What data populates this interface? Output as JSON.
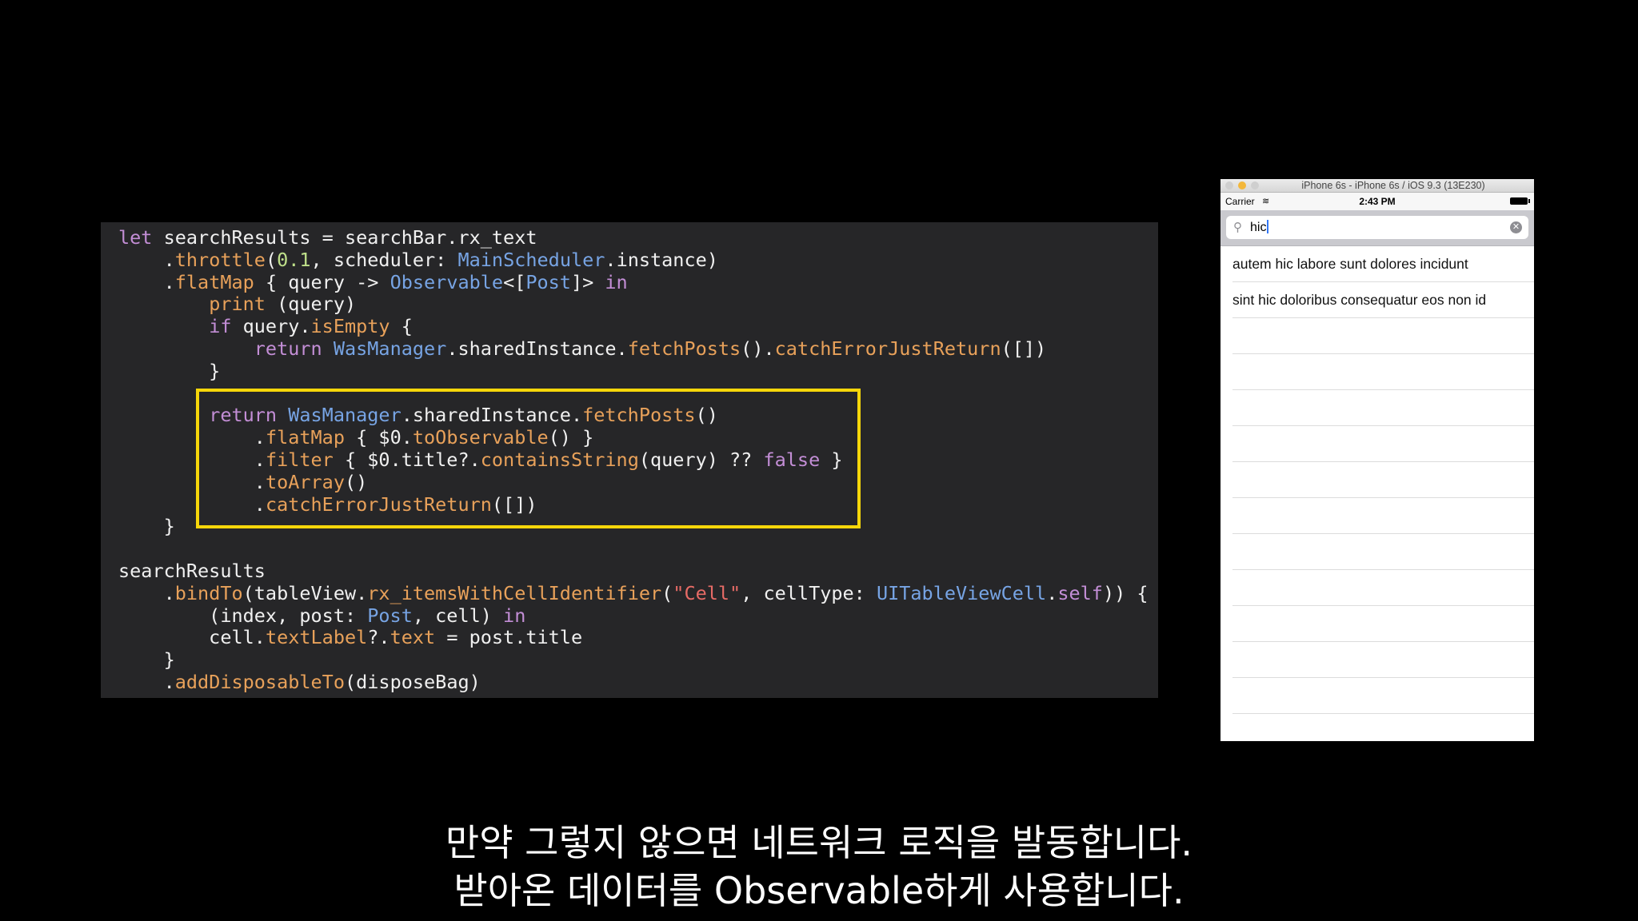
{
  "code": {
    "lines": [
      [
        [
          "k",
          "let"
        ],
        [
          "p",
          " searchResults = searchBar.rx_text"
        ]
      ],
      [
        [
          "p",
          "    ."
        ],
        [
          "f",
          "throttle"
        ],
        [
          "p",
          "("
        ],
        [
          "n",
          "0.1"
        ],
        [
          "p",
          ", scheduler: "
        ],
        [
          "ty",
          "MainScheduler"
        ],
        [
          "p",
          ".instance)"
        ]
      ],
      [
        [
          "p",
          "    ."
        ],
        [
          "f",
          "flatMap"
        ],
        [
          "p",
          " { query -> "
        ],
        [
          "ty",
          "Observable"
        ],
        [
          "p",
          "<["
        ],
        [
          "ty",
          "Post"
        ],
        [
          "p",
          "]> "
        ],
        [
          "k",
          "in"
        ]
      ],
      [
        [
          "p",
          "        "
        ],
        [
          "f",
          "print"
        ],
        [
          "p",
          " (query)"
        ]
      ],
      [
        [
          "p",
          "        "
        ],
        [
          "k",
          "if"
        ],
        [
          "p",
          " query."
        ],
        [
          "f",
          "isEmpty"
        ],
        [
          "p",
          " {"
        ]
      ],
      [
        [
          "p",
          "            "
        ],
        [
          "k",
          "return"
        ],
        [
          "p",
          " "
        ],
        [
          "ty",
          "WasManager"
        ],
        [
          "p",
          ".sharedInstance."
        ],
        [
          "f",
          "fetchPosts"
        ],
        [
          "p",
          "()."
        ],
        [
          "f",
          "catchErrorJustReturn"
        ],
        [
          "p",
          "([])"
        ]
      ],
      [
        [
          "p",
          "        }"
        ]
      ],
      [
        [
          "p",
          ""
        ]
      ],
      [
        [
          "p",
          "        "
        ],
        [
          "k",
          "return"
        ],
        [
          "p",
          " "
        ],
        [
          "ty",
          "WasManager"
        ],
        [
          "p",
          ".sharedInstance."
        ],
        [
          "f",
          "fetchPosts"
        ],
        [
          "p",
          "()"
        ]
      ],
      [
        [
          "p",
          "            ."
        ],
        [
          "f",
          "flatMap"
        ],
        [
          "p",
          " { $0."
        ],
        [
          "f",
          "toObservable"
        ],
        [
          "p",
          "() }"
        ]
      ],
      [
        [
          "p",
          "            ."
        ],
        [
          "f",
          "filter"
        ],
        [
          "p",
          " { $0.title?."
        ],
        [
          "f",
          "containsString"
        ],
        [
          "p",
          "(query) ?? "
        ],
        [
          "k",
          "false"
        ],
        [
          "p",
          " }"
        ]
      ],
      [
        [
          "p",
          "            ."
        ],
        [
          "f",
          "toArray"
        ],
        [
          "p",
          "()"
        ]
      ],
      [
        [
          "p",
          "            ."
        ],
        [
          "f",
          "catchErrorJustReturn"
        ],
        [
          "p",
          "([])"
        ]
      ],
      [
        [
          "p",
          "    }"
        ]
      ],
      [
        [
          "p",
          ""
        ]
      ],
      [
        [
          "p",
          "searchResults"
        ]
      ],
      [
        [
          "p",
          "    ."
        ],
        [
          "f",
          "bindTo"
        ],
        [
          "p",
          "(tableView."
        ],
        [
          "f",
          "rx_itemsWithCellIdentifier"
        ],
        [
          "p",
          "("
        ],
        [
          "s",
          "\"Cell\""
        ],
        [
          "p",
          ", cellType: "
        ],
        [
          "ty",
          "UITableViewCell"
        ],
        [
          "p",
          "."
        ],
        [
          "k",
          "self"
        ],
        [
          "p",
          ")) {"
        ]
      ],
      [
        [
          "p",
          "        (index, post: "
        ],
        [
          "ty",
          "Post"
        ],
        [
          "p",
          ", cell) "
        ],
        [
          "k",
          "in"
        ]
      ],
      [
        [
          "p",
          "        cell."
        ],
        [
          "f",
          "textLabel"
        ],
        [
          "p",
          "?."
        ],
        [
          "f",
          "text"
        ],
        [
          "p",
          " = post.title"
        ]
      ],
      [
        [
          "p",
          "    }"
        ]
      ],
      [
        [
          "p",
          "    ."
        ],
        [
          "f",
          "addDisposableTo"
        ],
        [
          "p",
          "(disposeBag)"
        ]
      ]
    ]
  },
  "colors": {
    "keyword": "#c38ed6",
    "function": "#e8a15a",
    "type": "#77a4e4",
    "number": "#bfe08a",
    "string": "#e76b66",
    "highlight_border": "#f6d60a",
    "ios_blue": "#3478f6"
  },
  "simulator": {
    "window_title": "iPhone 6s - iPhone 6s / iOS 9.3 (13E230)",
    "status_bar": {
      "carrier": "Carrier",
      "wifi_icon": "wifi-icon",
      "time": "2:43 PM",
      "battery_icon": "battery-icon"
    },
    "search": {
      "value": "hic",
      "search_icon": "search-icon",
      "clear_icon": "clear-icon"
    },
    "results": [
      "autem hic labore sunt dolores incidunt",
      "sint hic doloribus consequatur eos non id",
      "",
      "",
      "",
      "",
      "",
      "",
      "",
      "",
      "",
      "",
      "",
      ""
    ]
  },
  "subtitles": {
    "line1": "만약 그렇지 않으면 네트워크 로직을 발동합니다.",
    "line2": "받아온 데이터를 Observable하게 사용합니다."
  }
}
